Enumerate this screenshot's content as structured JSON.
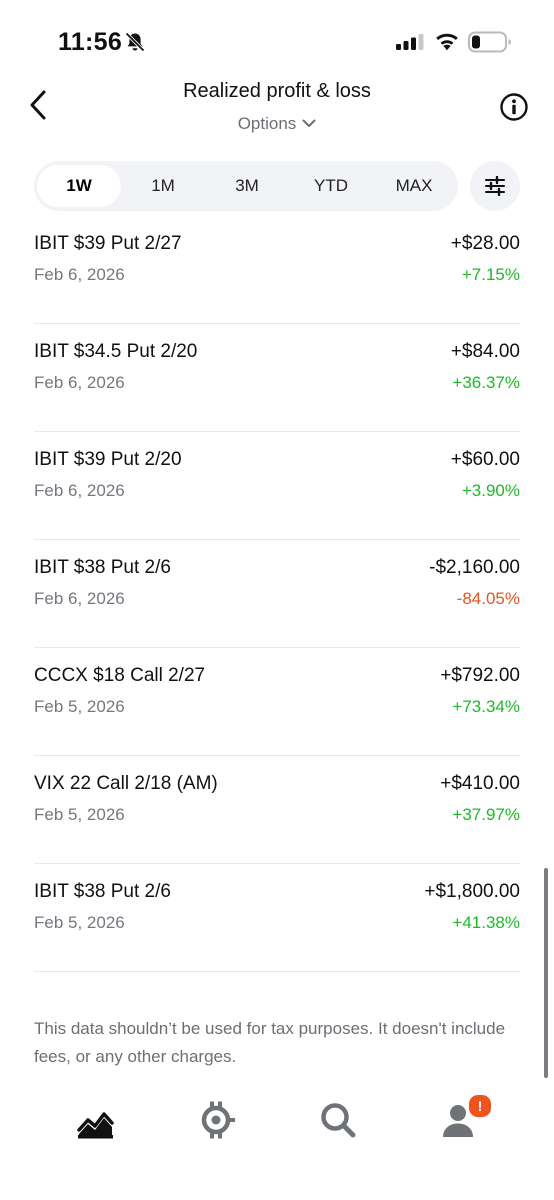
{
  "status_bar": {
    "time": "11:56"
  },
  "header": {
    "title": "Realized profit & loss",
    "subtitle": "Options"
  },
  "tabs": [
    {
      "label": "1W",
      "active": true
    },
    {
      "label": "1M",
      "active": false
    },
    {
      "label": "3M",
      "active": false
    },
    {
      "label": "YTD",
      "active": false
    },
    {
      "label": "MAX",
      "active": false
    }
  ],
  "trades": [
    {
      "name": "IBIT $39 Put 2/27",
      "date": "Feb 6, 2026",
      "amount": "+$28.00",
      "percent": "+7.15%",
      "direction": "positive"
    },
    {
      "name": "IBIT $34.5 Put 2/20",
      "date": "Feb 6, 2026",
      "amount": "+$84.00",
      "percent": "+36.37%",
      "direction": "positive"
    },
    {
      "name": "IBIT $39 Put 2/20",
      "date": "Feb 6, 2026",
      "amount": "+$60.00",
      "percent": "+3.90%",
      "direction": "positive"
    },
    {
      "name": "IBIT $38 Put 2/6",
      "date": "Feb 6, 2026",
      "amount": "-$2,160.00",
      "percent": "-84.05%",
      "direction": "negative"
    },
    {
      "name": "CCCX $18 Call 2/27",
      "date": "Feb 5, 2026",
      "amount": "+$792.00",
      "percent": "+73.34%",
      "direction": "positive"
    },
    {
      "name": "VIX 22 Call 2/18 (AM)",
      "date": "Feb 5, 2026",
      "amount": "+$410.00",
      "percent": "+37.97%",
      "direction": "positive"
    },
    {
      "name": "IBIT $38 Put 2/6",
      "date": "Feb 5, 2026",
      "amount": "+$1,800.00",
      "percent": "+41.38%",
      "direction": "positive"
    }
  ],
  "disclaimer": "This data shouldn’t be used for tax purposes. It doesn't include fees, or any other charges.",
  "bottom_nav": {
    "items": [
      {
        "icon": "portfolio-chart-icon",
        "active": true
      },
      {
        "icon": "crypto-icon",
        "active": false
      },
      {
        "icon": "search-icon",
        "active": false
      },
      {
        "icon": "account-icon",
        "active": false
      }
    ],
    "account_badge": "!"
  },
  "colors": {
    "positive": "#1fb82a",
    "negative": "#e8541e",
    "badge": "#f0541e",
    "tab_bg": "#f1f3f6"
  }
}
